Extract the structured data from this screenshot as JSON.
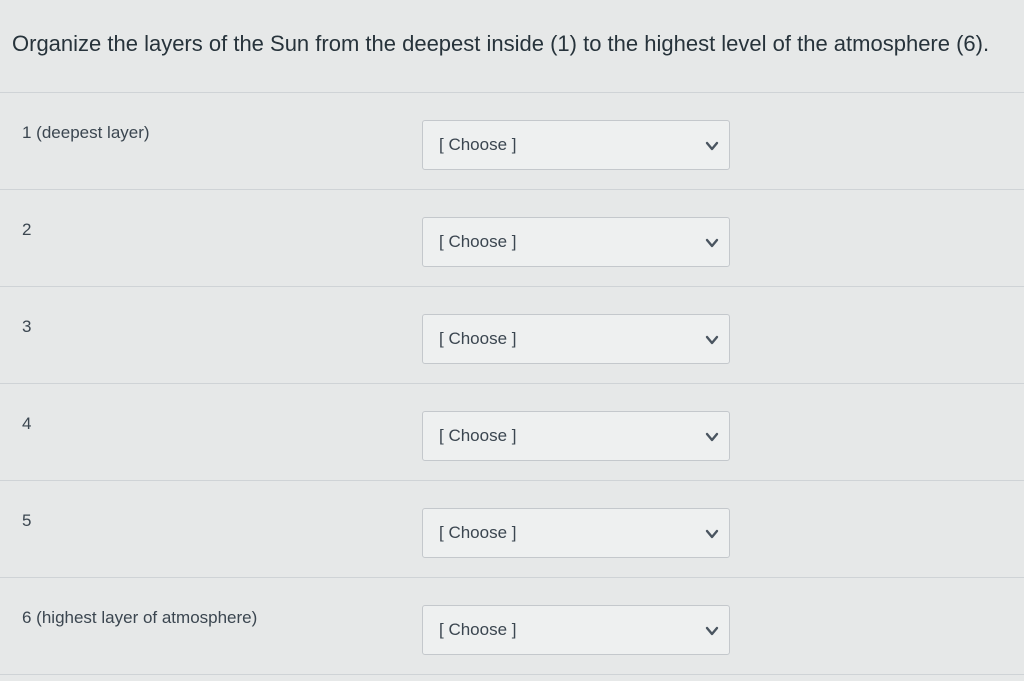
{
  "question": {
    "text": "Organize the layers of the Sun from the deepest inside (1) to the highest level of the atmosphere (6)."
  },
  "rows": [
    {
      "label": "1 (deepest layer)",
      "select_value": "[ Choose ]"
    },
    {
      "label": "2",
      "select_value": "[ Choose ]"
    },
    {
      "label": "3",
      "select_value": "[ Choose ]"
    },
    {
      "label": "4",
      "select_value": "[ Choose ]"
    },
    {
      "label": "5",
      "select_value": "[ Choose ]"
    },
    {
      "label": "6 (highest layer of atmosphere)",
      "select_value": "[ Choose ]"
    }
  ],
  "icons": {
    "dropdown": "chevron-down-icon"
  },
  "colors": {
    "background": "#e6e8e8",
    "text": "#2d3b45",
    "border": "#c4c8cc"
  }
}
